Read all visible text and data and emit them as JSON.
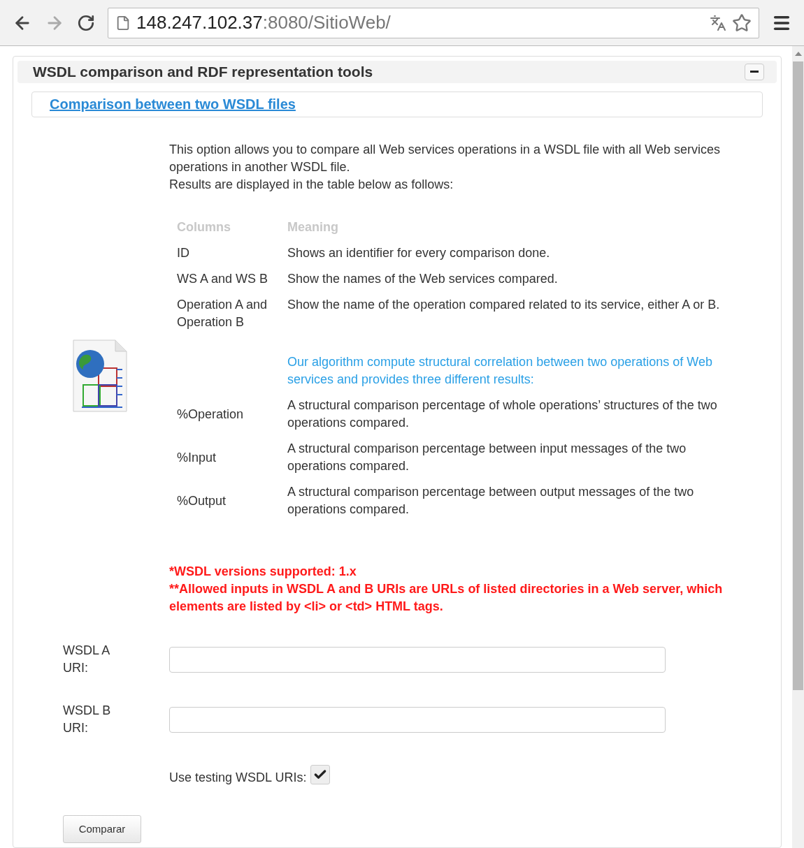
{
  "browser": {
    "url_host": "148.247.102.37",
    "url_path": ":8080/SitioWeb/"
  },
  "panel": {
    "title": "WSDL comparison and RDF representation tools",
    "link": "Comparison between two WSDL files"
  },
  "description": [
    "This option allows you to compare all Web services operations in a WSDL file with all Web services operations in another WSDL file.",
    "Results are displayed in the table below as follows:"
  ],
  "table": {
    "columns": [
      "Columns",
      "Meaning"
    ],
    "rows": [
      {
        "kind": "entry",
        "column": "ID",
        "meaning": "Shows an identifier for every comparison done."
      },
      {
        "kind": "entry",
        "column": "WS A and WS B",
        "meaning": "Show the names of the Web services compared."
      },
      {
        "kind": "entry",
        "column": "Operation A and Operation B",
        "meaning": "Show the name of the operation compared related to its service, either A or B."
      },
      {
        "kind": "note",
        "meaning": "Our algorithm compute structural correlation between two operations of Web services and provides three different results:"
      },
      {
        "kind": "entry",
        "column": "%Operation",
        "meaning": "A structural comparison percentage of whole operations’ structures of the two operations compared."
      },
      {
        "kind": "entry",
        "column": "%Input",
        "meaning": "A structural comparison percentage between input messages of the two operations compared."
      },
      {
        "kind": "entry",
        "column": "%Output",
        "meaning": "A structural comparison percentage between output messages of the two operations compared."
      }
    ]
  },
  "notes": [
    "*WSDL versions supported: 1.x",
    "**Allowed inputs in WSDL A and B URIs are URLs of listed directories in a Web server, which elements are listed by <li> or <td> HTML tags."
  ],
  "fields": [
    {
      "label": "WSDL A URI:"
    },
    {
      "label": "WSDL B URI:"
    }
  ],
  "checkbox": {
    "label": "Use testing WSDL URIs:",
    "checked": true
  },
  "button": "Comparar"
}
